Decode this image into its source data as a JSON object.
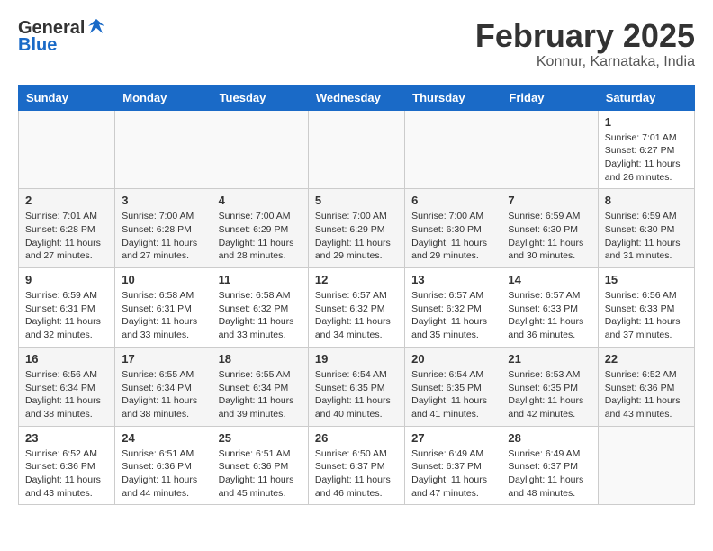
{
  "header": {
    "logo_general": "General",
    "logo_blue": "Blue",
    "title": "February 2025",
    "subtitle": "Konnur, Karnataka, India"
  },
  "days_of_week": [
    "Sunday",
    "Monday",
    "Tuesday",
    "Wednesday",
    "Thursday",
    "Friday",
    "Saturday"
  ],
  "weeks": [
    [
      {
        "day": "",
        "info": ""
      },
      {
        "day": "",
        "info": ""
      },
      {
        "day": "",
        "info": ""
      },
      {
        "day": "",
        "info": ""
      },
      {
        "day": "",
        "info": ""
      },
      {
        "day": "",
        "info": ""
      },
      {
        "day": "1",
        "info": "Sunrise: 7:01 AM\nSunset: 6:27 PM\nDaylight: 11 hours and 26 minutes."
      }
    ],
    [
      {
        "day": "2",
        "info": "Sunrise: 7:01 AM\nSunset: 6:28 PM\nDaylight: 11 hours and 27 minutes."
      },
      {
        "day": "3",
        "info": "Sunrise: 7:00 AM\nSunset: 6:28 PM\nDaylight: 11 hours and 27 minutes."
      },
      {
        "day": "4",
        "info": "Sunrise: 7:00 AM\nSunset: 6:29 PM\nDaylight: 11 hours and 28 minutes."
      },
      {
        "day": "5",
        "info": "Sunrise: 7:00 AM\nSunset: 6:29 PM\nDaylight: 11 hours and 29 minutes."
      },
      {
        "day": "6",
        "info": "Sunrise: 7:00 AM\nSunset: 6:30 PM\nDaylight: 11 hours and 29 minutes."
      },
      {
        "day": "7",
        "info": "Sunrise: 6:59 AM\nSunset: 6:30 PM\nDaylight: 11 hours and 30 minutes."
      },
      {
        "day": "8",
        "info": "Sunrise: 6:59 AM\nSunset: 6:30 PM\nDaylight: 11 hours and 31 minutes."
      }
    ],
    [
      {
        "day": "9",
        "info": "Sunrise: 6:59 AM\nSunset: 6:31 PM\nDaylight: 11 hours and 32 minutes."
      },
      {
        "day": "10",
        "info": "Sunrise: 6:58 AM\nSunset: 6:31 PM\nDaylight: 11 hours and 33 minutes."
      },
      {
        "day": "11",
        "info": "Sunrise: 6:58 AM\nSunset: 6:32 PM\nDaylight: 11 hours and 33 minutes."
      },
      {
        "day": "12",
        "info": "Sunrise: 6:57 AM\nSunset: 6:32 PM\nDaylight: 11 hours and 34 minutes."
      },
      {
        "day": "13",
        "info": "Sunrise: 6:57 AM\nSunset: 6:32 PM\nDaylight: 11 hours and 35 minutes."
      },
      {
        "day": "14",
        "info": "Sunrise: 6:57 AM\nSunset: 6:33 PM\nDaylight: 11 hours and 36 minutes."
      },
      {
        "day": "15",
        "info": "Sunrise: 6:56 AM\nSunset: 6:33 PM\nDaylight: 11 hours and 37 minutes."
      }
    ],
    [
      {
        "day": "16",
        "info": "Sunrise: 6:56 AM\nSunset: 6:34 PM\nDaylight: 11 hours and 38 minutes."
      },
      {
        "day": "17",
        "info": "Sunrise: 6:55 AM\nSunset: 6:34 PM\nDaylight: 11 hours and 38 minutes."
      },
      {
        "day": "18",
        "info": "Sunrise: 6:55 AM\nSunset: 6:34 PM\nDaylight: 11 hours and 39 minutes."
      },
      {
        "day": "19",
        "info": "Sunrise: 6:54 AM\nSunset: 6:35 PM\nDaylight: 11 hours and 40 minutes."
      },
      {
        "day": "20",
        "info": "Sunrise: 6:54 AM\nSunset: 6:35 PM\nDaylight: 11 hours and 41 minutes."
      },
      {
        "day": "21",
        "info": "Sunrise: 6:53 AM\nSunset: 6:35 PM\nDaylight: 11 hours and 42 minutes."
      },
      {
        "day": "22",
        "info": "Sunrise: 6:52 AM\nSunset: 6:36 PM\nDaylight: 11 hours and 43 minutes."
      }
    ],
    [
      {
        "day": "23",
        "info": "Sunrise: 6:52 AM\nSunset: 6:36 PM\nDaylight: 11 hours and 43 minutes."
      },
      {
        "day": "24",
        "info": "Sunrise: 6:51 AM\nSunset: 6:36 PM\nDaylight: 11 hours and 44 minutes."
      },
      {
        "day": "25",
        "info": "Sunrise: 6:51 AM\nSunset: 6:36 PM\nDaylight: 11 hours and 45 minutes."
      },
      {
        "day": "26",
        "info": "Sunrise: 6:50 AM\nSunset: 6:37 PM\nDaylight: 11 hours and 46 minutes."
      },
      {
        "day": "27",
        "info": "Sunrise: 6:49 AM\nSunset: 6:37 PM\nDaylight: 11 hours and 47 minutes."
      },
      {
        "day": "28",
        "info": "Sunrise: 6:49 AM\nSunset: 6:37 PM\nDaylight: 11 hours and 48 minutes."
      },
      {
        "day": "",
        "info": ""
      }
    ]
  ]
}
